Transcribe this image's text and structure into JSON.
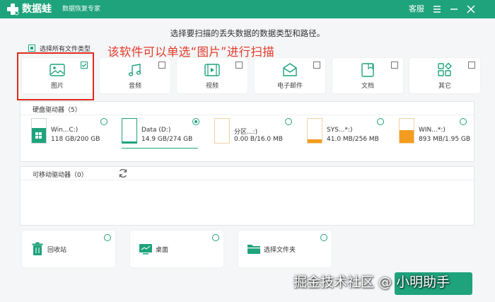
{
  "titlebar": {
    "app_name": "数据蛙",
    "app_subtitle": "数据恢复专家",
    "support_label": "客服",
    "bg_color": "#1fa37c"
  },
  "instruction": "选择要扫描的丢失数据的数据类型和路径。",
  "select_all": {
    "label": "选择所有文件类型",
    "checked": true
  },
  "annotation": "该软件可以单选“图片”进行扫描",
  "file_types": [
    {
      "label": "图片",
      "icon": "image-icon",
      "checked": true
    },
    {
      "label": "音频",
      "icon": "music-icon",
      "checked": false
    },
    {
      "label": "视频",
      "icon": "video-icon",
      "checked": false
    },
    {
      "label": "电子邮件",
      "icon": "mail-icon",
      "checked": false
    },
    {
      "label": "文档",
      "icon": "document-icon",
      "checked": false
    },
    {
      "label": "其它",
      "icon": "other-icon",
      "checked": false
    }
  ],
  "hdd": {
    "title": "硬盘驱动器（5）",
    "drives": [
      {
        "name": "Win...C:)",
        "size": "118 GB/200 GB",
        "selected": false
      },
      {
        "name": "Data (D:)",
        "size": "14.9 GB/274 GB",
        "selected": true
      },
      {
        "name": "分区...:)",
        "size": "0.00  B/16.0 MB",
        "selected": false
      },
      {
        "name": "SYS...*:)",
        "size": "41.0 MB/256 MB",
        "selected": false
      },
      {
        "name": "WIN...*:)",
        "size": "893 MB/1.95 GB",
        "selected": false
      }
    ]
  },
  "usb": {
    "title": "可移动驱动器（0）"
  },
  "locations": [
    {
      "label": "回收站",
      "icon": "recycle-bin-icon"
    },
    {
      "label": "桌面",
      "icon": "desktop-icon"
    },
    {
      "label": "选择文件夹",
      "icon": "folder-icon"
    }
  ],
  "watermark": "掘金技术社区 @ 小明助手",
  "colors": {
    "accent": "#1fa37c",
    "annotation_red": "#e12b1f",
    "drive_orange": "#f39c1f"
  }
}
